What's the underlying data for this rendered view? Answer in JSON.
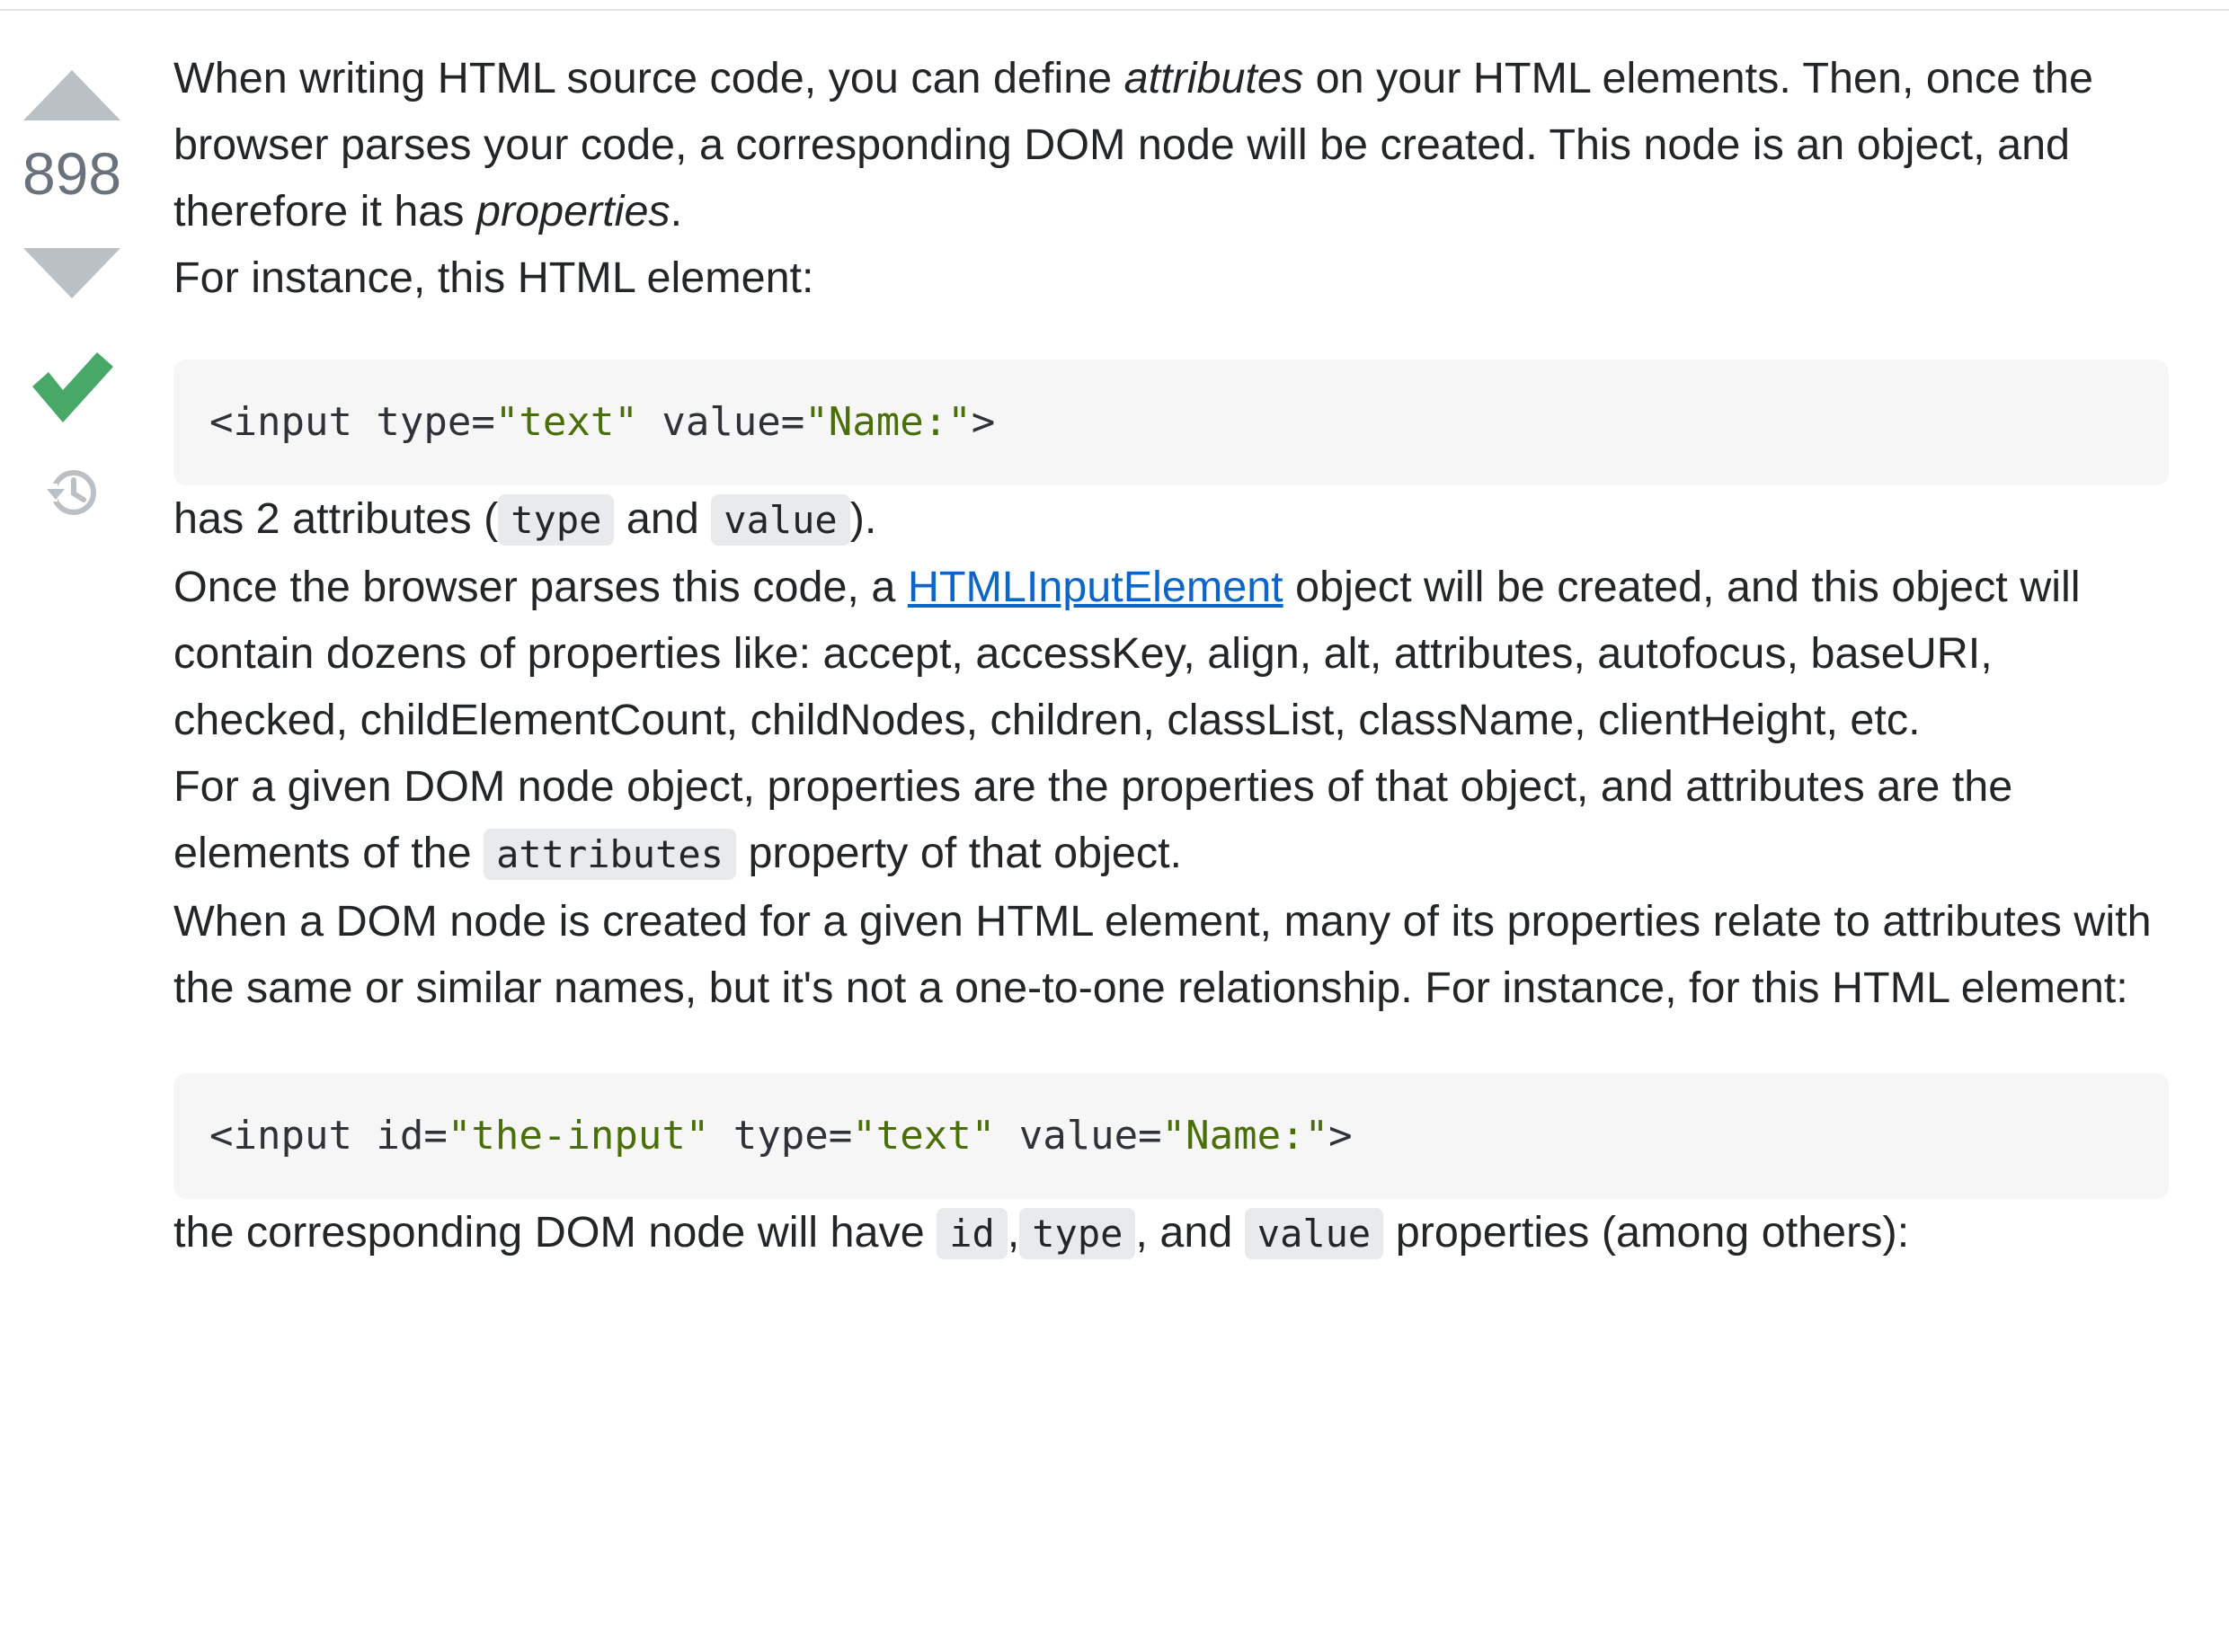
{
  "vote": {
    "count": "898"
  },
  "post": {
    "p1": {
      "a": "When writing HTML source code, you can define ",
      "b": "attributes",
      "c": " on your HTML elements. Then, once the browser parses your code, a corresponding DOM node will be created. This node is an object, and therefore it has ",
      "d": "properties",
      "e": "."
    },
    "p2": "For instance, this HTML element:",
    "code1": {
      "t1": "<input type=",
      "s1": "\"text\"",
      "t2": " value=",
      "s2": "\"Name:\"",
      "t3": ">"
    },
    "p3": {
      "a": "has 2 attributes (",
      "code_a": "type",
      "b": " and ",
      "code_b": "value",
      "c": ")."
    },
    "p4": {
      "a": "Once the browser parses this code, a ",
      "link": "HTMLInputElement",
      "b": " object will be created, and this object will contain dozens of properties like: accept, accessKey, align, alt, attributes, autofocus, baseURI, checked, childElementCount, childNodes, children, classList, className, clientHeight, etc."
    },
    "p5": {
      "a": "For a given DOM node object, properties are the properties of that object, and attributes are the elements of the ",
      "code": "attributes",
      "b": " property of that object."
    },
    "p6": "When a DOM node is created for a given HTML element, many of its properties relate to attributes with the same or similar names, but it's not a one-to-one relationship. For instance, for this HTML element:",
    "code2": {
      "t1": "<input id=",
      "s1": "\"the-input\"",
      "t2": " type=",
      "s2": "\"text\"",
      "t3": " value=",
      "s3": "\"Name:\"",
      "t4": ">"
    },
    "p7": {
      "a": "the corresponding DOM node will have ",
      "code_a": "id",
      "sep1": ",",
      "code_b": "type",
      "sep2": ", and ",
      "code_c": "value",
      "b": " properties (among others):"
    }
  },
  "colors": {
    "vote_arrow": "#bbc0c4",
    "accepted": "#48a868",
    "link": "#0c65c9",
    "code_bg": "#f6f6f6",
    "string": "#4a6f08"
  },
  "icons": {
    "upvote": "triangle-up",
    "downvote": "triangle-down",
    "accepted": "check-mark",
    "history": "clock-history"
  }
}
